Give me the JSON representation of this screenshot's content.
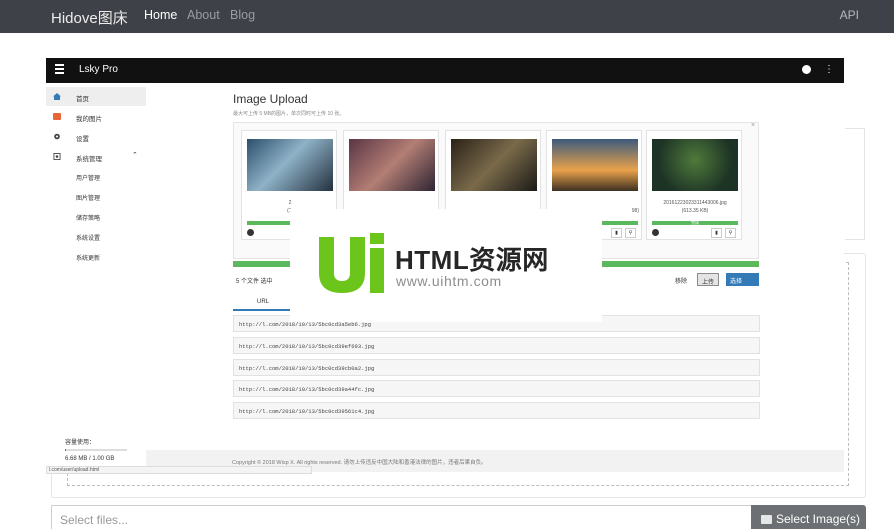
{
  "navbar": {
    "brand": "Hidove图床",
    "links": [
      "Home",
      "About",
      "Blog"
    ],
    "api": "API"
  },
  "inner": {
    "title": "Lsky Pro",
    "sidebar": {
      "items": [
        {
          "label": "首页",
          "icon": "home-icon"
        },
        {
          "label": "我的图片",
          "icon": "image-icon"
        },
        {
          "label": "设置",
          "icon": "gear-icon"
        },
        {
          "label": "系统管理",
          "icon": "admin-icon"
        }
      ],
      "subitems": [
        "用户管理",
        "图片管理",
        "储存策略",
        "系统设置",
        "系统更新"
      ],
      "quota_label": "容量使用：",
      "quota_value": "6.68 MB / 1.00 GB",
      "quota_fraction": 0.0065
    },
    "status_url": "l.com/user/upload.html",
    "upload": {
      "title": "Image Upload",
      "subtitle": "最大可上传 5 MB的图片，单次同时可上传 10 张。",
      "thumbs": [
        {
          "caption1": "2",
          "caption2": "(1."
        },
        {
          "caption1": "",
          "caption2": ""
        },
        {
          "caption1": "",
          "caption2": ""
        },
        {
          "caption1": "",
          "caption2": "98)"
        },
        {
          "caption1": "20161223023311443006.jpg",
          "caption2": "(613.35 KB)",
          "done": "完成"
        }
      ],
      "file_info": "5 个文件 选中",
      "remove": "移除",
      "upload_btn": "上传",
      "select_btn": "选择",
      "url_tab": "URL",
      "urls": [
        "http://l.com/2018/10/13/5bc0cd3a5eb6.jpg",
        "http://l.com/2018/10/13/5bc0cd39ef693.jpg",
        "http://l.com/2018/10/13/5bc0cd39cb0a2.jpg",
        "http://l.com/2018/10/13/5bc0cd39a44fc.jpg",
        "http://l.com/2018/10/13/5bc0cd39561c4.jpg"
      ]
    },
    "footer": "Copyright © 2018 Wisp X. All rights reserved. 请勿上传违反中国大陆和香港法律的图片，违者后果自负。"
  },
  "watermark": {
    "big": "HTML资源网",
    "small": "www.uihtm.com"
  },
  "bottom": {
    "placeholder": "Select files...",
    "select_button": "Select Image(s)"
  },
  "colors": {
    "navbar": "#3e4147",
    "accent": "#337ab7",
    "progress": "#5cb85c",
    "logo_green": "#6cc51b"
  }
}
